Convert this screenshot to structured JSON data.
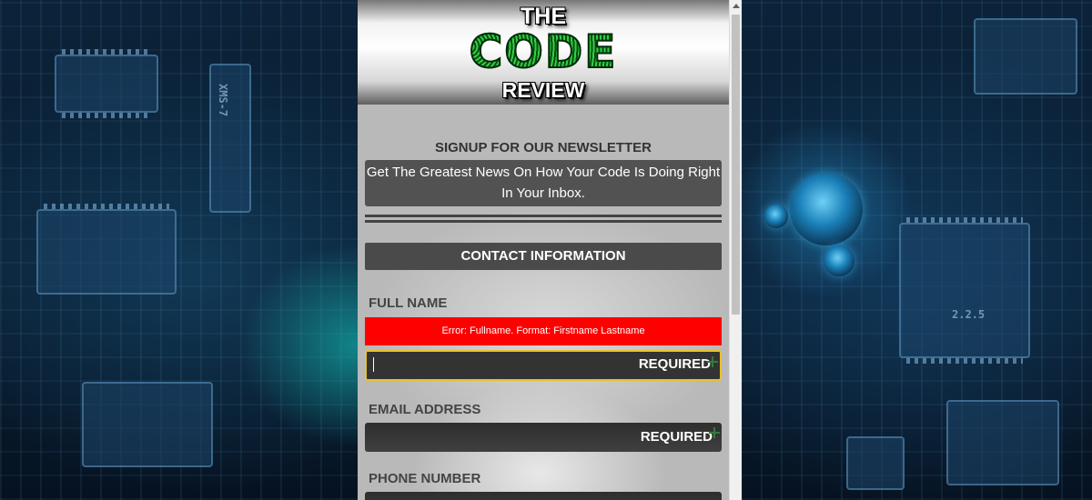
{
  "logo": {
    "top": "THE",
    "middle": "CODE",
    "bottom": "REVIEW"
  },
  "newsletter": {
    "title": "SIGNUP FOR OUR NEWSLETTER",
    "description": "Get The Greatest News On How Your Code Is Doing Right In Your Inbox."
  },
  "contact": {
    "section_title": "CONTACT INFORMATION",
    "full_name": {
      "label": "FULL NAME",
      "error": "Error: Fullname. Format: Firstname Lastname",
      "placeholder": "REQUIRED",
      "value": ""
    },
    "email": {
      "label": "EMAIL ADDRESS",
      "placeholder": "REQUIRED",
      "value": ""
    },
    "phone": {
      "label": "PHONE NUMBER"
    }
  },
  "background": {
    "chip_labels": [
      "XMS-7",
      "2.2.5"
    ]
  },
  "colors": {
    "error": "#ff0000",
    "focus_border": "#e7c22a",
    "logo_green": "#1c8f2a",
    "section_bar": "#4a4a4a"
  }
}
